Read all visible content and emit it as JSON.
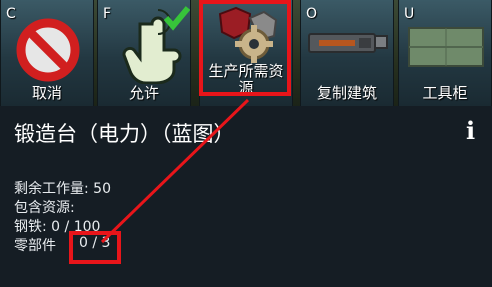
{
  "toolbar": {
    "buttons": [
      {
        "key": "C",
        "label": "取消",
        "icon": "cancel-icon"
      },
      {
        "key": "F",
        "label": "允许",
        "icon": "allow-hand-icon"
      },
      {
        "key": "",
        "label": "生产所需资源",
        "label_line1": "生产所需资",
        "label_line2": "源",
        "icon": "resources-icon"
      },
      {
        "key": "O",
        "label": "复制建筑",
        "icon": "copy-building-icon"
      },
      {
        "key": "U",
        "label": "工具柜",
        "icon": "tool-cabinet-icon"
      }
    ]
  },
  "panel": {
    "title": "锻造台（电力）（蓝图）",
    "info_icon": "i",
    "work_remaining": "剩余工作量: 50",
    "contains_resources": "包含资源:",
    "steel": "钢铁: 0 / 100",
    "parts_label": "零部件",
    "parts_value": "0 / 3"
  },
  "colors": {
    "highlight": "#e8151a",
    "panel_bg": "#151d24",
    "button_bg": "#233842"
  }
}
